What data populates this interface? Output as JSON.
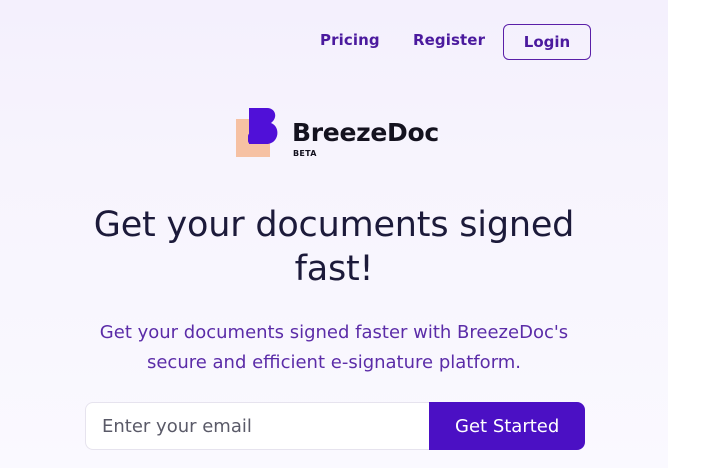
{
  "nav": {
    "pricing": "Pricing",
    "register": "Register",
    "login": "Login"
  },
  "brand": {
    "name": "BreezeDoc",
    "badge": "BETA",
    "colors": {
      "primary": "#4b10c4",
      "accent_peach": "#f6c1a3",
      "logo_purple": "#5010d8"
    }
  },
  "hero": {
    "headline": "Get your documents signed fast!",
    "subtext": "Get your documents signed faster with BreezeDoc's secure and efficient e-signature platform."
  },
  "signup": {
    "email_placeholder": "Enter your email",
    "email_value": "",
    "cta": "Get Started"
  }
}
